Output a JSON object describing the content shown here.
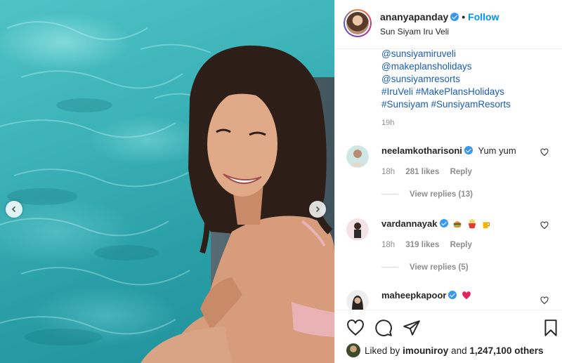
{
  "post": {
    "username": "ananyapanday",
    "follow_label": "Follow",
    "separator": "•",
    "location": "Sun Siyam Iru Veli"
  },
  "caption": {
    "lines": [
      "@sunsiyamiruveli",
      "@makeplansholidays",
      "@sunsiyamresorts",
      "#IruVeli #MakePlansHolidays",
      "#Sunsiyam #SunsiyamResorts"
    ],
    "time": "19h"
  },
  "comments": [
    {
      "username": "neelamkotharisoni",
      "text": "Yum yum",
      "time": "18h",
      "likes": "281 likes",
      "reply": "Reply",
      "view_replies": "View replies (13)"
    },
    {
      "username": "vardannayak",
      "text": "",
      "emojis": [
        "hamburger",
        "fries",
        "beer"
      ],
      "time": "18h",
      "likes": "319 likes",
      "reply": "Reply",
      "view_replies": "View replies (5)"
    },
    {
      "username": "maheepkapoor",
      "text": "",
      "emojis": [
        "red-heart"
      ]
    }
  ],
  "actions": {
    "liked_by_prefix": "Liked by",
    "liked_by_user": "imouniroy",
    "and_word": "and",
    "others": "1,247,100 others"
  },
  "colors": {
    "accent": "#0095f6",
    "verified": "#3897f0",
    "muted": "#8e8e8e"
  },
  "icons": [
    "chevron-left-icon",
    "chevron-right-icon",
    "verified-badge-icon",
    "heart-icon",
    "comment-icon",
    "share-icon",
    "bookmark-icon"
  ]
}
